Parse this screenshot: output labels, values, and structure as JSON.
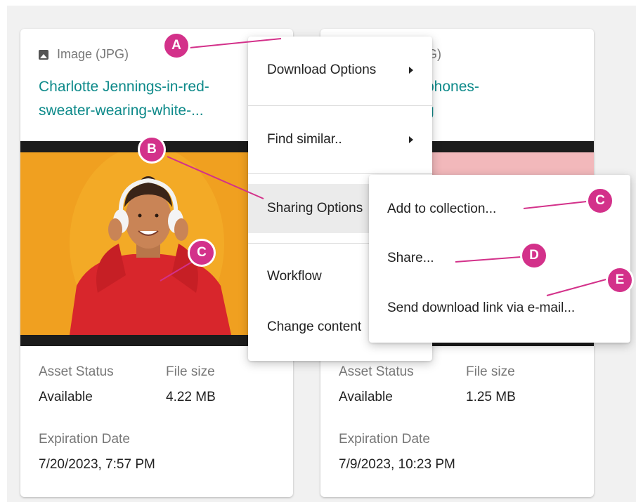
{
  "cards": [
    {
      "type_label": "Image (JPG)",
      "title_line1": "Charlotte Jennings-in-red-",
      "title_line2": "sweater-wearing-white-...",
      "asset_status_label": "Asset Status",
      "asset_status_value": "Available",
      "file_size_label": "File size",
      "file_size_value": "4.22 MB",
      "expiration_label": "Expiration Date",
      "expiration_value": "7/20/2023, 7:57 PM"
    },
    {
      "type_label": "PG)",
      "title_line1": "phones-",
      "title_line2": "g",
      "asset_status_label": "Asset Status",
      "asset_status_value": "Available",
      "file_size_label": "File size",
      "file_size_value": "1.25 MB",
      "expiration_label": "Expiration Date",
      "expiration_value": "7/9/2023, 10:23 PM"
    }
  ],
  "context_menu": {
    "items": [
      {
        "label": "Download Options",
        "has_submenu": true
      },
      {
        "label": "Find similar..",
        "has_submenu": true
      },
      {
        "label": "Sharing Options",
        "has_submenu": true,
        "active": true
      },
      {
        "label": "Workflow",
        "has_submenu": false
      },
      {
        "label": "Change content",
        "has_submenu": false
      }
    ]
  },
  "sharing_submenu": {
    "items": [
      {
        "label": "Add to collection..."
      },
      {
        "label": "Share..."
      },
      {
        "label": "Send download link via e-mail..."
      }
    ]
  },
  "callouts": {
    "a": "A",
    "b": "B",
    "c_image": "C",
    "c_menu": "C",
    "d": "D",
    "e": "E"
  },
  "colors": {
    "accent_teal": "#0e8a8a",
    "callout_pink": "#d3318a",
    "photo_orange": "#f0a020",
    "photo_pink": "#f2b8bb"
  }
}
